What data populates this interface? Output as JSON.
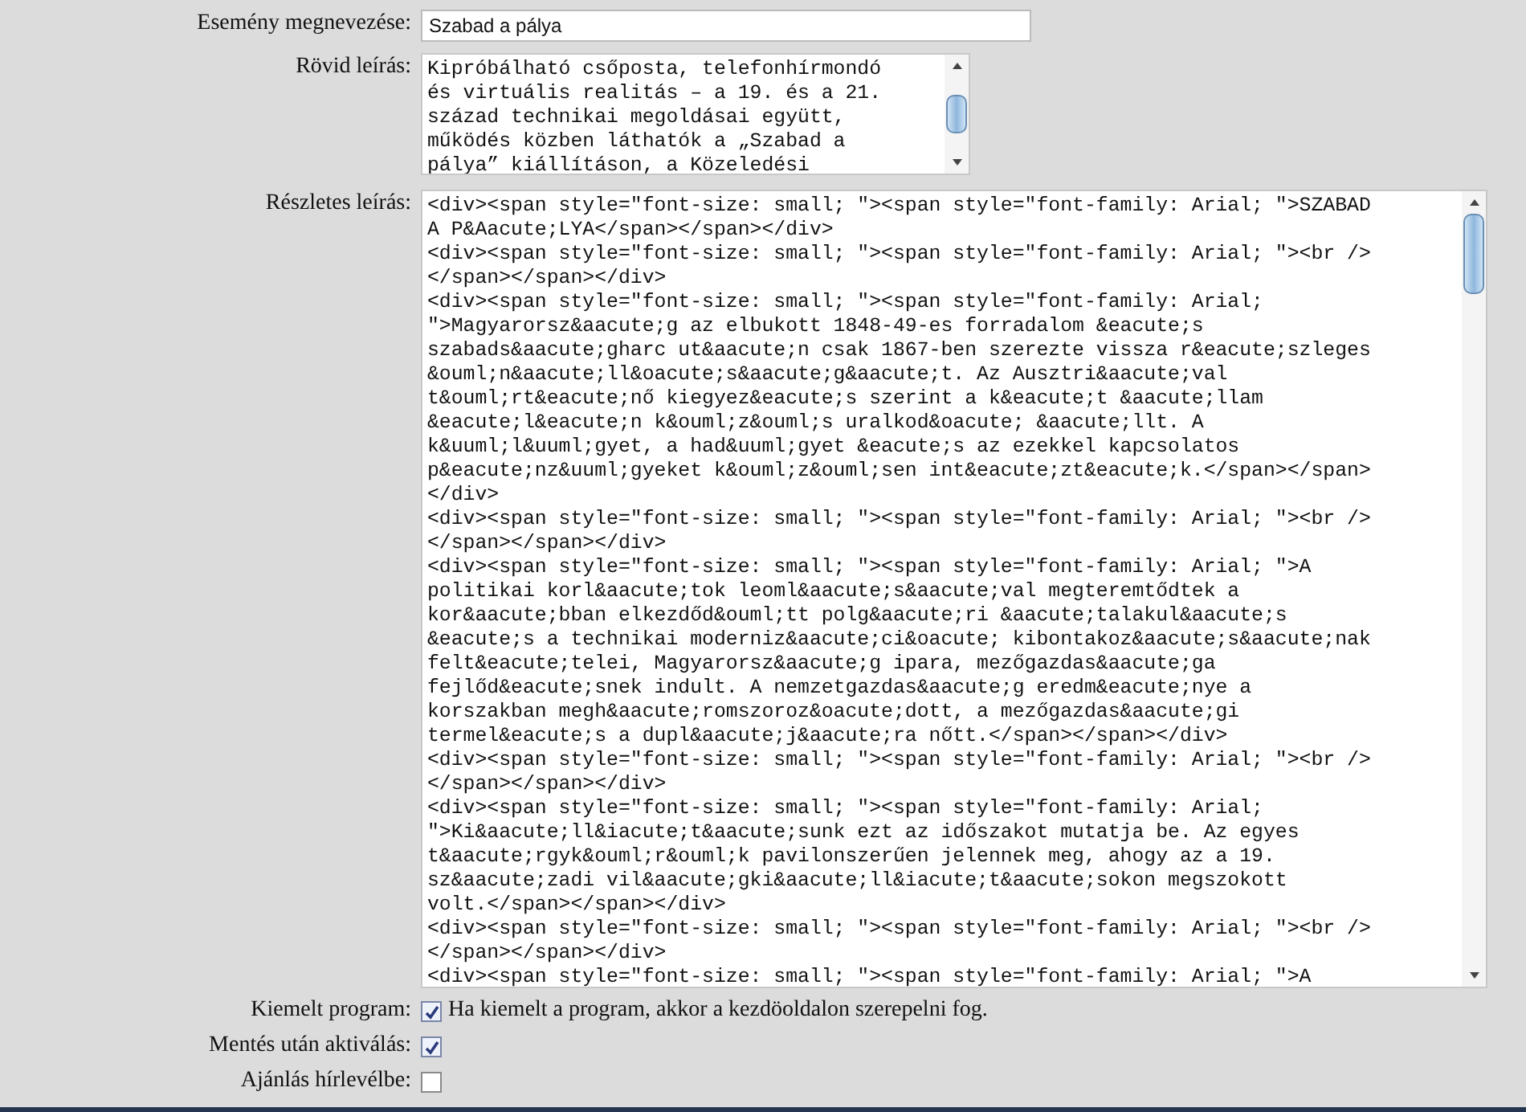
{
  "event_name": {
    "label": "Esemény megnevezése:",
    "value": "Szabad a pálya"
  },
  "short_description": {
    "label": "Rövid leírás:",
    "lines": [
      "Kipróbálható csőposta, telefonhírmondó",
      "és virtuális realitás – a 19. és a 21.",
      "század technikai megoldásai együtt,",
      "működés közben láthatók a „Szabad a",
      "pálya” kiállításon, a Közeledési"
    ]
  },
  "detailed_description": {
    "label": "Részletes leírás:",
    "lines": [
      "<div><span style=\"font-size: small; \"><span style=\"font-family: Arial; \">SZABAD",
      "A P&Aacute;LYA</span></span></div>",
      "<div><span style=\"font-size: small; \"><span style=\"font-family: Arial; \"><br />",
      "</span></span></div>",
      "<div><span style=\"font-size: small; \"><span style=\"font-family: Arial;",
      "\">Magyarorsz&aacute;g az elbukott 1848-49-es forradalom &eacute;s",
      "szabads&aacute;gharc ut&aacute;n csak 1867-ben szerezte vissza r&eacute;szleges",
      "&ouml;n&aacute;ll&oacute;s&aacute;g&aacute;t. Az Ausztri&aacute;val",
      "t&ouml;rt&eacute;nő kiegyez&eacute;s szerint a k&eacute;t &aacute;llam",
      "&eacute;l&eacute;n k&ouml;z&ouml;s uralkod&oacute; &aacute;llt. A",
      "k&uuml;l&uuml;gyet, a had&uuml;gyet &eacute;s az ezekkel kapcsolatos",
      "p&eacute;nz&uuml;gyeket k&ouml;z&ouml;sen int&eacute;zt&eacute;k.</span></span>",
      "</div>",
      "<div><span style=\"font-size: small; \"><span style=\"font-family: Arial; \"><br />",
      "</span></span></div>",
      "<div><span style=\"font-size: small; \"><span style=\"font-family: Arial; \">A",
      "politikai korl&aacute;tok leoml&aacute;s&aacute;val megteremtődtek a",
      "kor&aacute;bban elkezdőd&ouml;tt polg&aacute;ri &aacute;talakul&aacute;s",
      "&eacute;s a technikai moderniz&aacute;ci&oacute; kibontakoz&aacute;s&aacute;nak",
      "felt&eacute;telei, Magyarorsz&aacute;g ipara, mezőgazdas&aacute;ga",
      "fejlőd&eacute;snek indult. A nemzetgazdas&aacute;g eredm&eacute;nye a",
      "korszakban megh&aacute;romszoroz&oacute;dott, a mezőgazdas&aacute;gi",
      "termel&eacute;s a dupl&aacute;j&aacute;ra nőtt.</span></span></div>",
      "<div><span style=\"font-size: small; \"><span style=\"font-family: Arial; \"><br />",
      "</span></span></div>",
      "<div><span style=\"font-size: small; \"><span style=\"font-family: Arial;",
      "\">Ki&aacute;ll&iacute;t&aacute;sunk ezt az időszakot mutatja be. Az egyes",
      "t&aacute;rgyk&ouml;r&ouml;k pavilonszerűen jelennek meg, ahogy az a 19.",
      "sz&aacute;zadi vil&aacute;gki&aacute;ll&iacute;t&aacute;sokon megszokott",
      "volt.</span></span></div>",
      "<div><span style=\"font-size: small; \"><span style=\"font-family: Arial; \"><br />",
      "</span></span></div>",
      "<div><span style=\"font-size: small; \"><span style=\"font-family: Arial; \">A"
    ]
  },
  "options": [
    {
      "label": "Kiemelt program:",
      "checked": true,
      "hint": "Ha kiemelt a program, akkor a kezdöoldalon szerepelni fog."
    },
    {
      "label": "Mentés után aktiválás:",
      "checked": true
    },
    {
      "label": "Ajánlás hírlevélbe:",
      "checked": false
    }
  ]
}
